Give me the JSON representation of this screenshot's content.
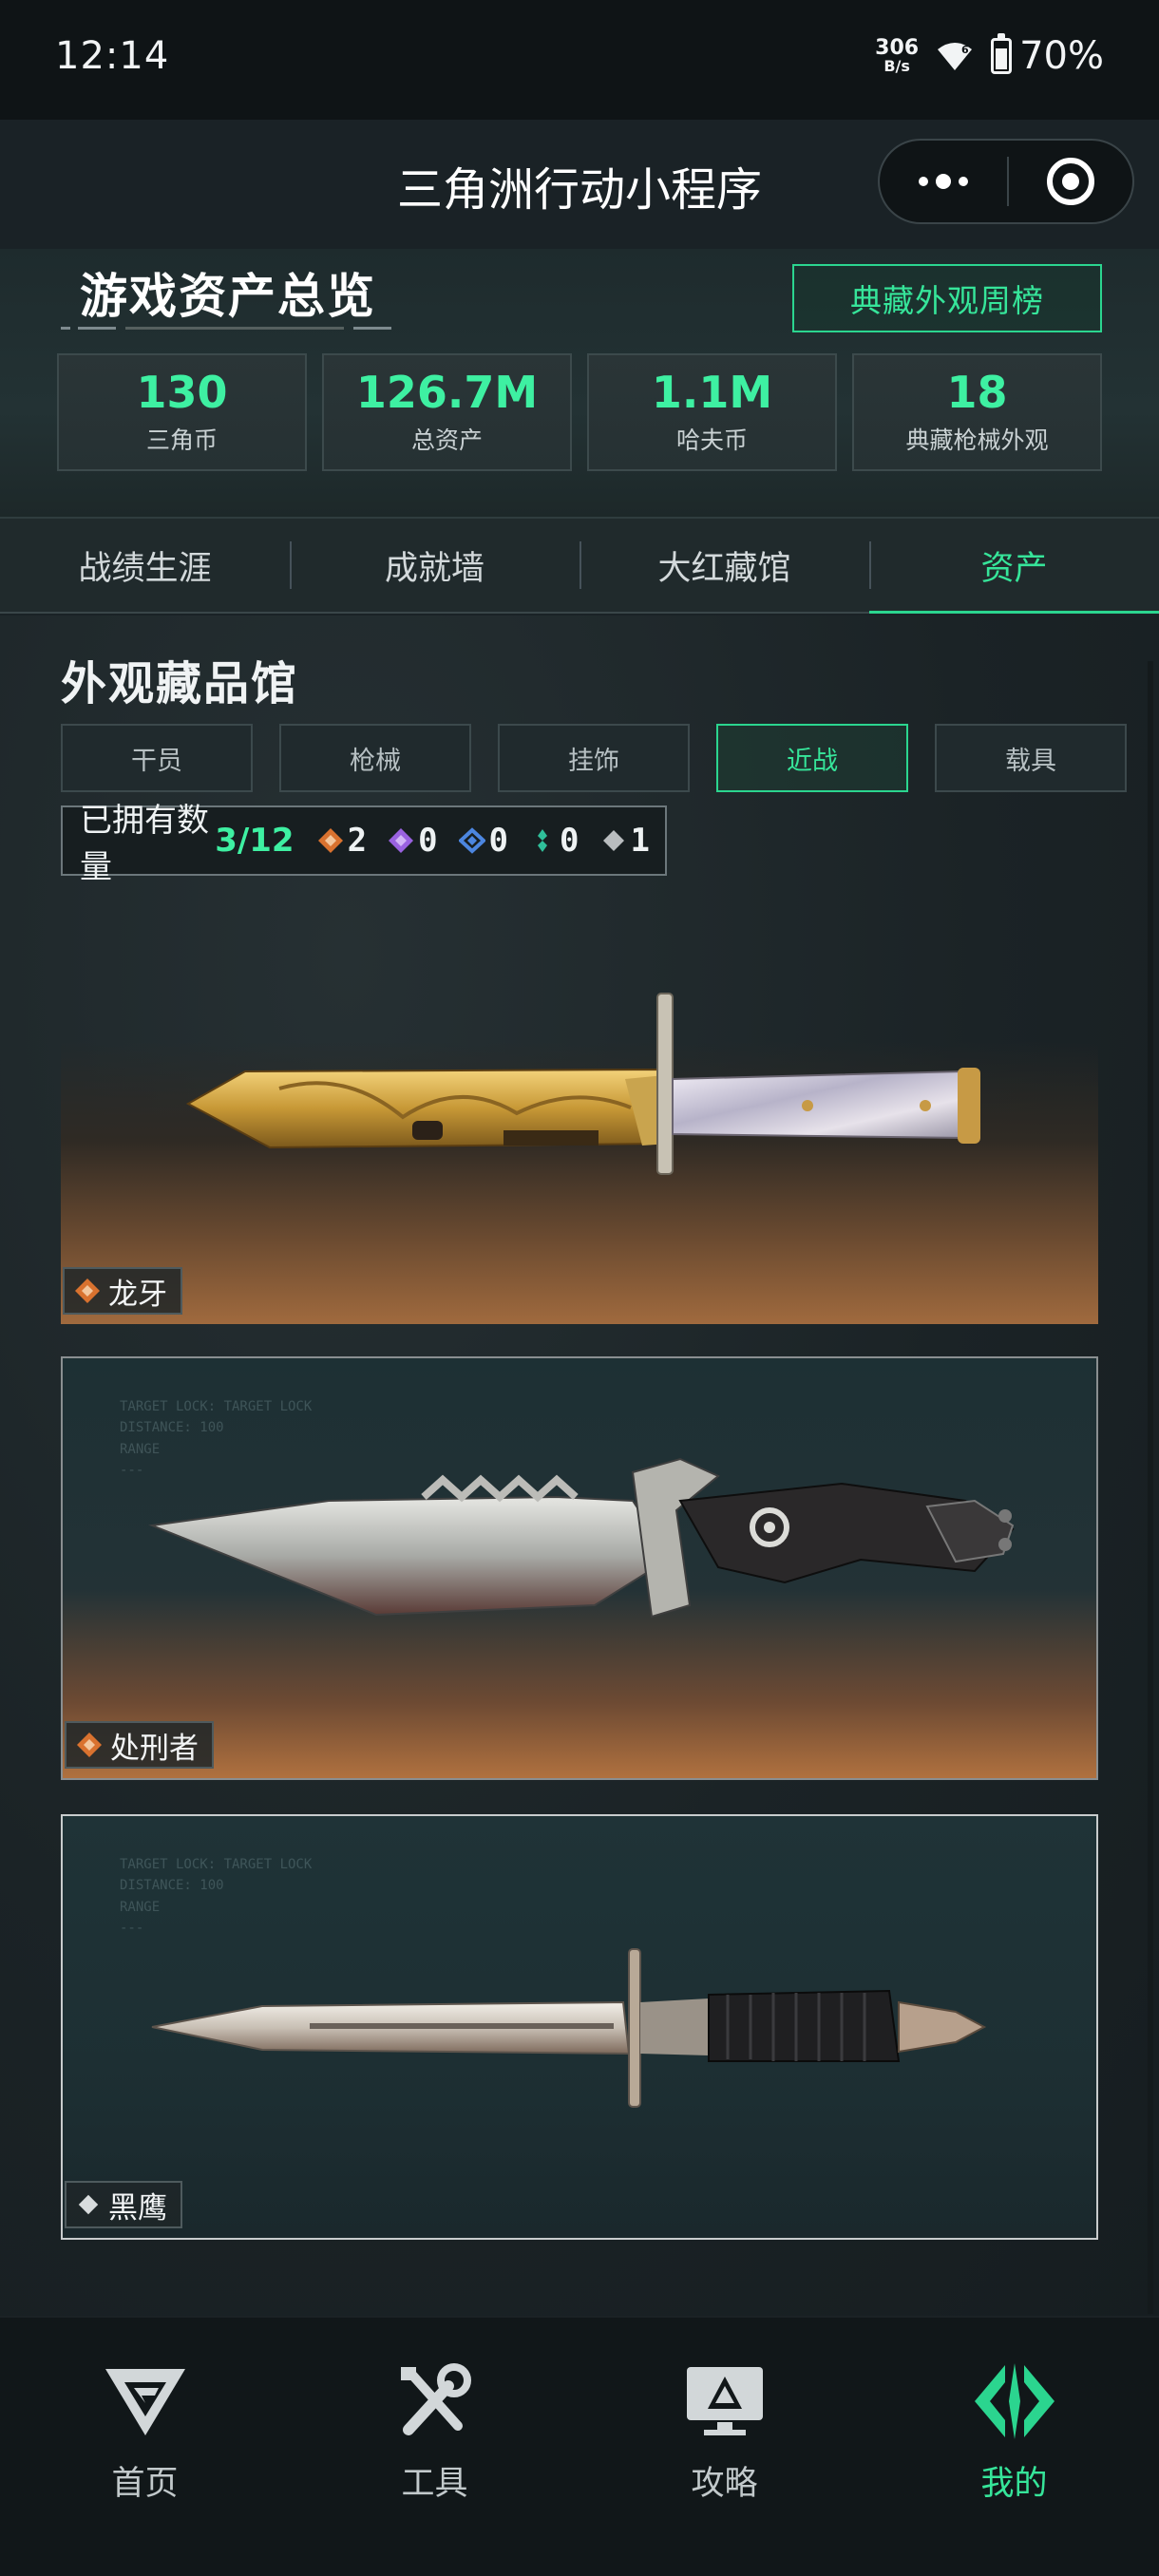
{
  "status_bar": {
    "time": "12:14",
    "net_speed_value": "306",
    "net_speed_unit": "B/s",
    "battery": "70%",
    "battery_level": 0.7
  },
  "nav": {
    "title": "三角洲行动小程序"
  },
  "overview": {
    "title": "游戏资产总览",
    "rank_button": "典藏外观周榜",
    "stats": [
      {
        "value": "130",
        "label": "三角币"
      },
      {
        "value": "126.7M",
        "label": "总资产"
      },
      {
        "value": "1.1M",
        "label": "哈夫币"
      },
      {
        "value": "18",
        "label": "典藏枪械外观"
      }
    ]
  },
  "tabs": [
    {
      "label": "战绩生涯",
      "active": false
    },
    {
      "label": "成就墙",
      "active": false
    },
    {
      "label": "大红藏馆",
      "active": false
    },
    {
      "label": "资产",
      "active": true
    }
  ],
  "collection": {
    "title": "外观藏品馆",
    "filters": [
      {
        "label": "干员",
        "active": false
      },
      {
        "label": "枪械",
        "active": false
      },
      {
        "label": "挂饰",
        "active": false
      },
      {
        "label": "近战",
        "active": true
      },
      {
        "label": "载具",
        "active": false
      }
    ],
    "owned_label": "已拥有数量",
    "owned_count": "3/12",
    "rarity_counts": [
      {
        "color": "#d9722f",
        "count": "2"
      },
      {
        "color": "#9a62e0",
        "count": "0"
      },
      {
        "color": "#4c86e0",
        "count": "0"
      },
      {
        "color": "#2fbf9a",
        "count": "0"
      },
      {
        "color": "#b9bdbf",
        "count": "1"
      }
    ],
    "items": [
      {
        "name": "龙牙",
        "rarity_color": "#d9722f"
      },
      {
        "name": "处刑者",
        "rarity_color": "#d9722f"
      },
      {
        "name": "黑鹰",
        "rarity_color": "#d8dcdd"
      }
    ]
  },
  "bottom_nav": [
    {
      "label": "首页",
      "icon": "delta-logo-icon",
      "active": false
    },
    {
      "label": "工具",
      "icon": "tools-icon",
      "active": false
    },
    {
      "label": "攻略",
      "icon": "monitor-guide-icon",
      "active": false
    },
    {
      "label": "我的",
      "icon": "profile-diamond-icon",
      "active": true
    }
  ],
  "colors": {
    "accent": "#36e59a",
    "background": "#1a2226",
    "legendary": "#d9722f"
  }
}
